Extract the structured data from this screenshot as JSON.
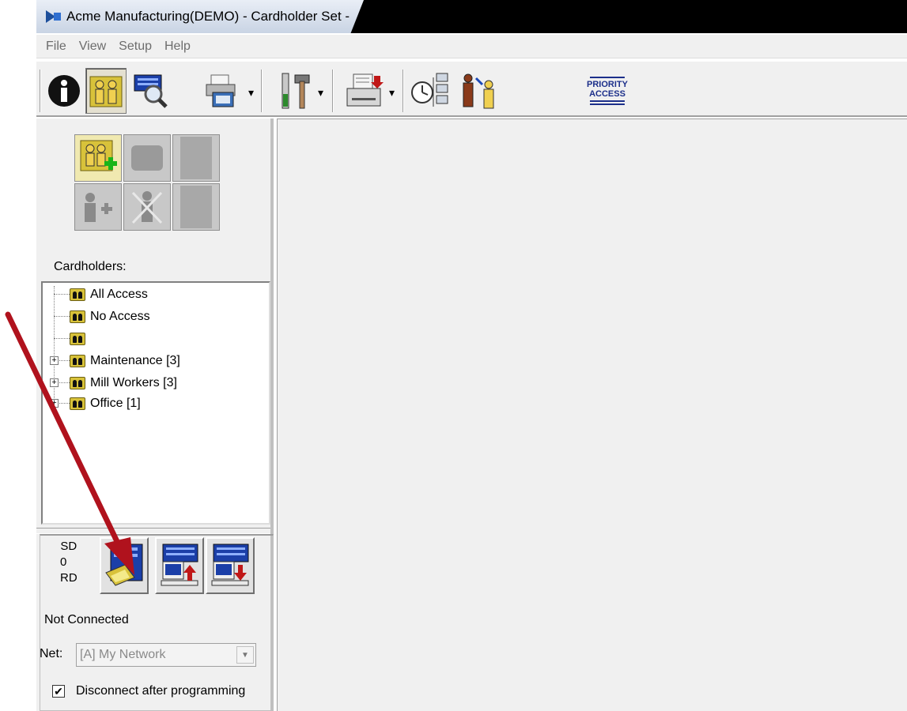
{
  "window": {
    "title": "Acme Manufacturing(DEMO) - Cardholder Set -"
  },
  "menu": {
    "items": [
      "File",
      "View",
      "Setup",
      "Help"
    ]
  },
  "toolbar": {
    "buttons": [
      "info-icon",
      "cardholders-icon",
      "monitor-icon",
      "printer-icon",
      "tools-icon",
      "reports-icon",
      "schedule-icon",
      "card-holder-move-icon",
      "priority-access-icon"
    ],
    "priority_label_line1": "PRIORITY",
    "priority_label_line2": "ACCESS"
  },
  "left": {
    "cardholders_label": "Cardholders:",
    "tree": [
      {
        "label": "All Access",
        "expandable": false
      },
      {
        "label": "No Access",
        "expandable": false
      },
      {
        "label": "",
        "expandable": false
      },
      {
        "label": "Maintenance [3]",
        "expandable": true
      },
      {
        "label": "Mill Workers [3]",
        "expandable": true
      },
      {
        "label": "Office [1]",
        "expandable": true
      }
    ],
    "sd_label": "SD",
    "count": "0",
    "rd_label": "RD",
    "status": "Not Connected",
    "net_label": "Net:",
    "net_value": "[A] My Network",
    "disconnect_label": "Disconnect after programming",
    "disconnect_checked": true
  },
  "colors": {
    "annotation_arrow": "#b0121d",
    "titlebar": "#000000",
    "panel": "#f0f0f0"
  }
}
